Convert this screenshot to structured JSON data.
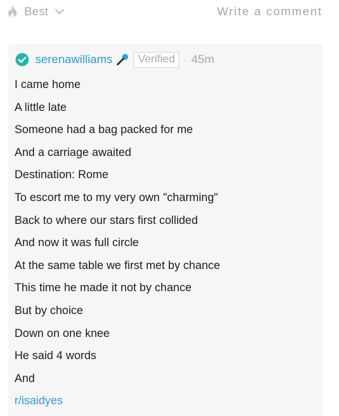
{
  "topbar": {
    "sort_icon": "flame-icon",
    "sort_label": "Best",
    "sort_chevron_icon": "chevron-down-icon",
    "write_comment": "Write a comment"
  },
  "comment": {
    "username": "serenawilliams",
    "flair": "Verified",
    "separator": "·",
    "time_ago": "45m",
    "icons": {
      "verified": "verified-check-icon",
      "flair_emoji": "microphone-icon"
    },
    "lines": [
      "I came home",
      "A little late",
      "Someone had a bag packed for me",
      "And a carriage awaited",
      "Destination: Rome",
      "To escort me to my very own \"charming\"",
      "Back to where our stars first collided",
      "And now it was full circle",
      "At the same table we first met by chance",
      "This time he made it not by chance",
      "But by choice",
      "Down on one knee",
      "He said 4 words",
      "And"
    ],
    "link": "r/isaidyes"
  },
  "colors": {
    "link_blue": "#2f9bd3",
    "muted_gray": "#a8a8ab",
    "card_bg": "#f6f6f6",
    "text": "#1c1c1c"
  }
}
